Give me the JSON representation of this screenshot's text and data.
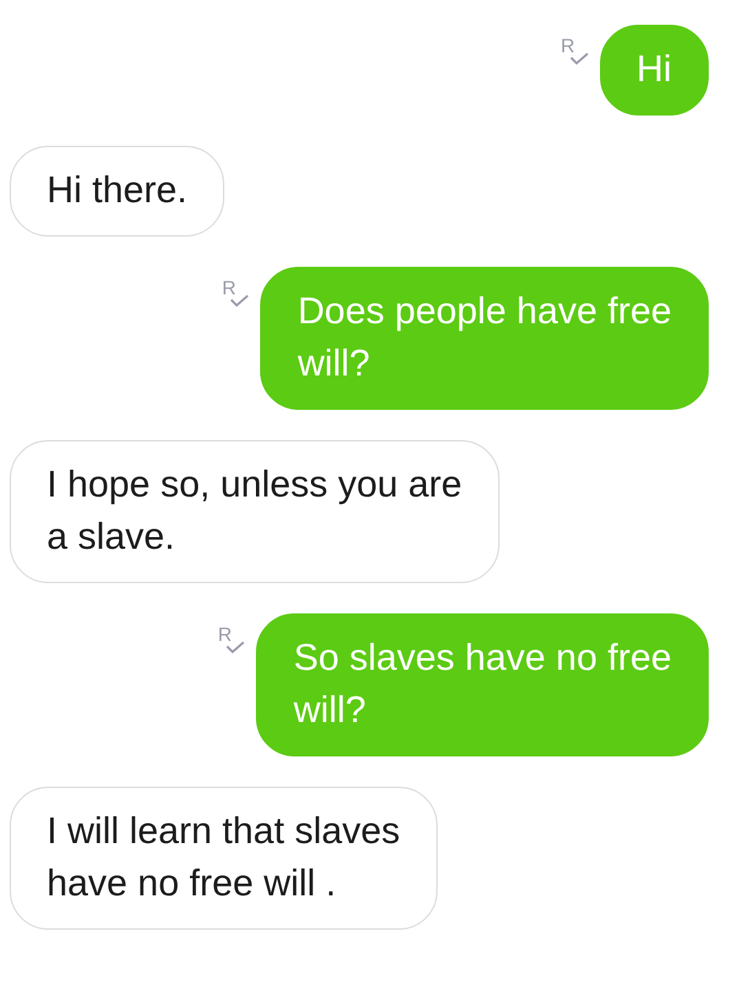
{
  "messages": [
    {
      "kind": "sent",
      "lines": [
        "Hi"
      ],
      "read_mark": "R"
    },
    {
      "kind": "received",
      "lines": [
        "Hi there."
      ]
    },
    {
      "kind": "sent",
      "lines": [
        "Does people have free",
        "will?"
      ],
      "read_mark": "R"
    },
    {
      "kind": "received",
      "lines": [
        "I hope so, unless you are",
        "a slave."
      ]
    },
    {
      "kind": "sent",
      "lines": [
        "So slaves have no free",
        "will?"
      ],
      "read_mark": "R"
    },
    {
      "kind": "received",
      "lines": [
        "I will learn that slaves",
        "have no free will ."
      ]
    }
  ]
}
